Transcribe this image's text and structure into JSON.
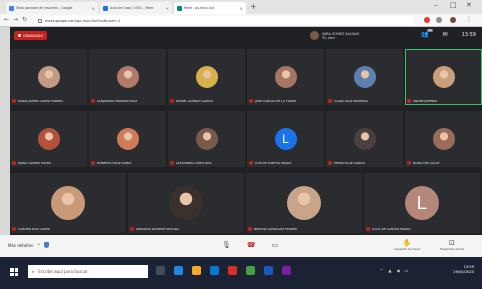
{
  "browser": {
    "tabs": [
      {
        "title": "Tesla ganador de resumen - Google",
        "favicon_color": "#4285f4"
      },
      {
        "title": "Aula de clase 1 ESO – Meet",
        "favicon_color": "#1a73e8"
      },
      {
        "title": "Meet - gu-mxcj-kut",
        "favicon_color": "#00897b"
      }
    ],
    "new_tab": "+",
    "window_controls": [
      "–",
      "□",
      "✕"
    ],
    "url": "meet.google.com/gu-mxcj-kut?authuser=1"
  },
  "meeting": {
    "recording_label": "GRABANDO",
    "presenter": {
      "name": "SARA GOMEZ SALINAS",
      "subtitle": "Tú, cám"
    },
    "people_badge": "29",
    "time": "13:59",
    "participants": [
      {
        "name": "MARIA JOSEFA LOPEZ TORRES",
        "avatar_color": "#c29a86",
        "kind": "photo"
      },
      {
        "name": "ALEJANDRO MORENO RUIZ",
        "avatar_color": "#b07a66",
        "kind": "photo"
      },
      {
        "name": "RAFAEL ALONSO GARCÍA",
        "avatar_color": "#d6b04a",
        "kind": "photo"
      },
      {
        "name": "JOSE CARLOS DE LA TORRE",
        "avatar_color": "#a77662",
        "kind": "photo"
      },
      {
        "name": "CLARA DIAZ ESPINOSA",
        "avatar_color": "#5f7fb0",
        "kind": "photo"
      },
      {
        "name": "ANDER JIMENEZ",
        "avatar_color": "#caa07c",
        "kind": "photo",
        "speaking": true
      },
      {
        "name": "PABLO GOMEZ SOLER",
        "avatar_color": "#b3513c",
        "kind": "photo"
      },
      {
        "name": "ROBERTO CRUZ RUBIO",
        "avatar_color": "#d07a5a",
        "kind": "photo"
      },
      {
        "name": "ALEXANDRA ORTIZ ROS",
        "avatar_color": "#7a5a4a",
        "kind": "photo"
      },
      {
        "name": "LUIS DE SANTOS PRADO",
        "avatar_color": "#1a73e8",
        "kind": "letter",
        "letter": "L"
      },
      {
        "name": "PEDRO RUIZ GARCIA",
        "avatar_color": "#4a4040",
        "kind": "photo"
      },
      {
        "name": "NURIA DEL VALLE",
        "avatar_color": "#9a6c5c",
        "kind": "photo"
      },
      {
        "name": "CARMEN RUIZ LOPEZ",
        "avatar_color": "#c89a7a",
        "kind": "photo"
      },
      {
        "name": "GERARDO RAMIREZ SEGURA",
        "avatar_color": "#3a302c",
        "kind": "photo"
      },
      {
        "name": "BEATRIZ GONZALEZ FERRER",
        "avatar_color": "#c8a48a",
        "kind": "photo"
      },
      {
        "name": "LUCIA DE SANTOS PRADO",
        "avatar_color": "#b4877a",
        "kind": "letter",
        "letter": "L"
      }
    ]
  },
  "callbar": {
    "meeting_label": "Más detalles",
    "raise_hand": "Levantar la mano",
    "present": "Presentar ahora"
  },
  "taskbar": {
    "search_placeholder": "Escribe aquí para buscar",
    "time": "13:59",
    "date": "29/04/2020"
  }
}
